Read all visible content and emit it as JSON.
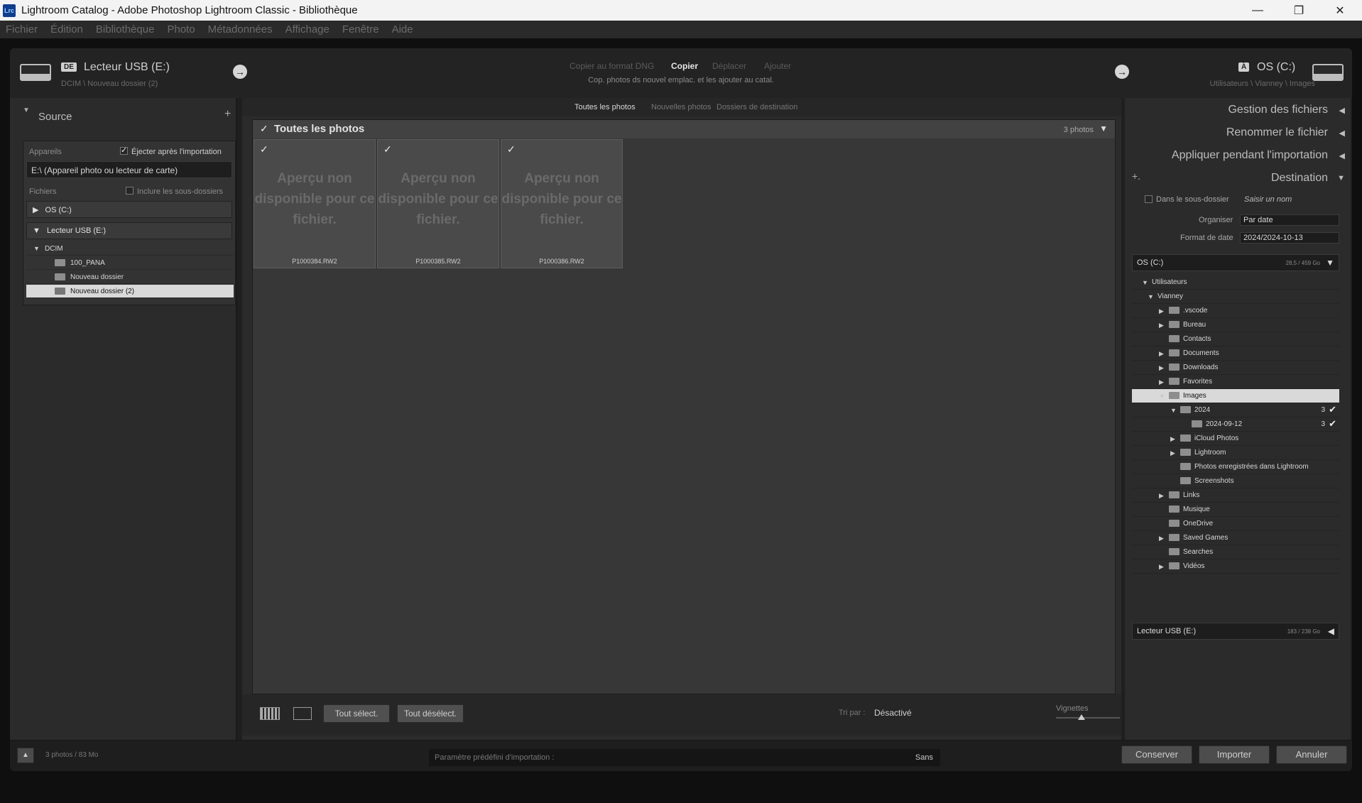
{
  "window": {
    "title": "Lightroom Catalog - Adobe Photoshop Lightroom Classic - Bibliothèque",
    "app_icon": "Lrc"
  },
  "menu": [
    "Fichier",
    "Édition",
    "Bibliothèque",
    "Photo",
    "Métadonnées",
    "Affichage",
    "Fenêtre",
    "Aide"
  ],
  "source_header": {
    "tag": "DE",
    "name": "Lecteur USB (E:)",
    "path": "DCIM \\ Nouveau dossier (2)"
  },
  "dest_header": {
    "tag": "À",
    "name": "OS (C:)",
    "path": "Utilisateurs \\ Vianney \\ Images"
  },
  "modes": {
    "dng": "Copier au format DNG",
    "copy": "Copier",
    "move": "Déplacer",
    "add": "Ajouter",
    "description": "Cop. photos ds nouvel emplac. et les ajouter au catal."
  },
  "left": {
    "source_title": "Source",
    "devices_label": "Appareils",
    "eject_label": "Éjecter après l'importation",
    "device_name": "E:\\ (Appareil photo ou lecteur de carte)",
    "files_label": "Fichiers",
    "subfolders_label": "Inclure les sous-dossiers",
    "volumes": [
      "OS (C:)",
      "Lecteur USB (E:)"
    ],
    "folders": [
      "DCIM",
      "100_PANA",
      "Nouveau dossier",
      "Nouveau dossier (2)"
    ]
  },
  "center": {
    "tabs": [
      "Toutes les photos",
      "Nouvelles photos",
      "Dossiers de destination"
    ],
    "grid_title": "Toutes les photos",
    "count": "3 photos",
    "unavailable": "Aperçu non disponible pour ce fichier.",
    "photos": [
      "P1000384.RW2",
      "P1000385.RW2",
      "P1000386.RW2"
    ],
    "select_all": "Tout sélect.",
    "deselect_all": "Tout désélect.",
    "sort_label": "Tri par :",
    "sort_value": "Désactivé",
    "thumbs_label": "Vignettes"
  },
  "right": {
    "file_handling": "Gestion des fichiers",
    "rename": "Renommer le fichier",
    "apply": "Appliquer pendant l'importation",
    "destination": "Destination",
    "subfolder_label": "Dans le sous-dossier",
    "subfolder_placeholder": "Saisir un nom",
    "organize_label": "Organiser",
    "organize_value": "Par date",
    "date_format_label": "Format de date",
    "date_format_value": "2024/2024-10-13",
    "volume_c": "OS (C:)",
    "volume_c_cap": "28,5 / 459 Go",
    "volume_e": "Lecteur USB (E:)",
    "volume_e_cap": "183 / 238 Go",
    "tree": [
      {
        "label": "Utilisateurs",
        "count": "",
        "tick": ""
      },
      {
        "label": "Vianney",
        "count": "",
        "tick": ""
      },
      {
        "label": ".vscode",
        "count": "",
        "tick": ""
      },
      {
        "label": "Bureau",
        "count": "",
        "tick": ""
      },
      {
        "label": "Contacts",
        "count": "",
        "tick": ""
      },
      {
        "label": "Documents",
        "count": "",
        "tick": ""
      },
      {
        "label": "Downloads",
        "count": "",
        "tick": ""
      },
      {
        "label": "Favorites",
        "count": "",
        "tick": ""
      },
      {
        "label": "Images",
        "count": "",
        "tick": ""
      },
      {
        "label": "2024",
        "count": "3",
        "tick": "✔"
      },
      {
        "label": "2024-09-12",
        "count": "3",
        "tick": "✔"
      },
      {
        "label": "iCloud Photos",
        "count": "",
        "tick": ""
      },
      {
        "label": "Lightroom",
        "count": "",
        "tick": ""
      },
      {
        "label": "Photos enregistrées dans Lightroom",
        "count": "",
        "tick": ""
      },
      {
        "label": "Screenshots",
        "count": "",
        "tick": ""
      },
      {
        "label": "Links",
        "count": "",
        "tick": ""
      },
      {
        "label": "Musique",
        "count": "",
        "tick": ""
      },
      {
        "label": "OneDrive",
        "count": "",
        "tick": ""
      },
      {
        "label": "Saved Games",
        "count": "",
        "tick": ""
      },
      {
        "label": "Searches",
        "count": "",
        "tick": ""
      },
      {
        "label": "Vidéos",
        "count": "",
        "tick": ""
      }
    ]
  },
  "footer": {
    "status": "3 photos / 83 Mo",
    "preset_label": "Paramètre prédéfini d'importation :",
    "preset_value": "Sans",
    "keep": "Conserver",
    "import": "Importer",
    "cancel": "Annuler"
  }
}
